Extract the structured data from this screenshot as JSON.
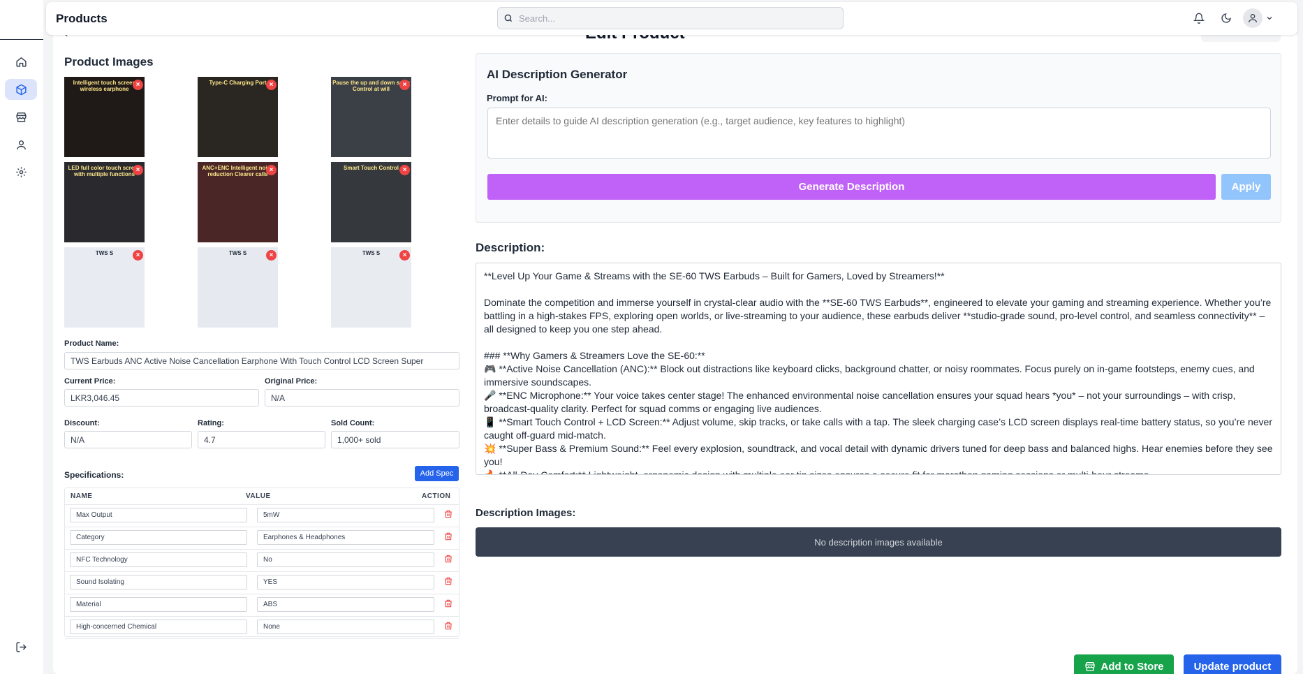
{
  "header": {
    "title": "Products",
    "search_placeholder": "Search..."
  },
  "page": {
    "heading": "Edit Product"
  },
  "product_images": {
    "title": "Product Images",
    "items": [
      {
        "caption": "Intelligent touch screen wireless earphone",
        "bg": "#1f1a17"
      },
      {
        "caption": "Type-C Charging Port",
        "bg": "#2a2622"
      },
      {
        "caption": "Pause the up and down song Control at will",
        "bg": "#3b3f46"
      },
      {
        "caption": "LED full color touch screen with multiple functions",
        "bg": "#2a2a2e"
      },
      {
        "caption": "ANC+ENC Intelligent noise reduction Clearer calls",
        "bg": "#4a2626"
      },
      {
        "caption": "Smart Touch Control",
        "bg": "#35393d"
      },
      {
        "caption": "TWS S",
        "bg": "#e8ecf2"
      },
      {
        "caption": "TWS S",
        "bg": "#e6eaf0"
      },
      {
        "caption": "TWS S",
        "bg": "#e8ebf0"
      }
    ]
  },
  "form": {
    "product_name_label": "Product Name:",
    "product_name": "TWS Earbuds ANC Active Noise Cancellation Earphone With Touch Control LCD Screen Super",
    "current_price_label": "Current Price:",
    "current_price": "LKR3,046.45",
    "original_price_label": "Original Price:",
    "original_price": "N/A",
    "discount_label": "Discount:",
    "discount": "N/A",
    "rating_label": "Rating:",
    "rating": "4.7",
    "sold_label": "Sold Count:",
    "sold": "1,000+ sold"
  },
  "specs": {
    "title": "Specifications:",
    "add_label": "Add Spec",
    "col_name": "NAME",
    "col_value": "VALUE",
    "col_action": "ACTION",
    "rows": [
      {
        "name": "Max Output",
        "value": "5mW"
      },
      {
        "name": "Category",
        "value": "Earphones & Headphones"
      },
      {
        "name": "NFC Technology",
        "value": "No"
      },
      {
        "name": "Sound Isolating",
        "value": "YES"
      },
      {
        "name": "Material",
        "value": "ABS"
      },
      {
        "name": "High-concerned Chemical",
        "value": "None"
      }
    ]
  },
  "ai": {
    "title": "AI Description Generator",
    "prompt_label": "Prompt for AI:",
    "prompt_placeholder": "Enter details to guide AI description generation (e.g., target audience, key features to highlight)",
    "generate_label": "Generate Description",
    "apply_label": "Apply"
  },
  "description": {
    "label": "Description:",
    "text": "**Level Up Your Game & Streams with the SE-60 TWS Earbuds – Built for Gamers, Loved by Streamers!**\n\nDominate the competition and immerse yourself in crystal-clear audio with the **SE-60 TWS Earbuds**, engineered to elevate your gaming and streaming experience. Whether you’re battling in a high-stakes FPS, exploring open worlds, or live-streaming to your audience, these earbuds deliver **studio-grade sound, pro-level control, and seamless connectivity** – all designed to keep you one step ahead.\n\n### **Why Gamers & Streamers Love the SE-60:**\n🎮 **Active Noise Cancellation (ANC):** Block out distractions like keyboard clicks, background chatter, or noisy roommates. Focus purely on in-game footsteps, enemy cues, and immersive soundscapes.\n🎤 **ENC Microphone:** Your voice takes center stage! The enhanced environmental noise cancellation ensures your squad hears *you* – not your surroundings – with crisp, broadcast-quality clarity. Perfect for squad comms or engaging live audiences.\n📱 **Smart Touch Control + LCD Screen:** Adjust volume, skip tracks, or take calls with a tap. The sleek charging case’s LCD screen displays real-time battery status, so you’re never caught off-guard mid-match.\n💥 **Super Bass & Premium Sound:** Feel every explosion, soundtrack, and vocal detail with dynamic drivers tuned for deep bass and balanced highs. Hear enemies before they see you!\n🔥 **All-Day Comfort:** Lightweight, ergonomic design with multiple ear tip sizes ensures a secure fit for marathon gaming sessions or multi-hour streams."
  },
  "description_images": {
    "label": "Description Images:",
    "empty_text": "No description images available"
  },
  "actions": {
    "add_to_store": "Add to Store",
    "update": "Update product"
  },
  "colors": {
    "primary": "#2563eb",
    "generate": "#c061f7",
    "apply": "#93c5fd",
    "success": "#16a34a",
    "danger": "#ef4444"
  }
}
